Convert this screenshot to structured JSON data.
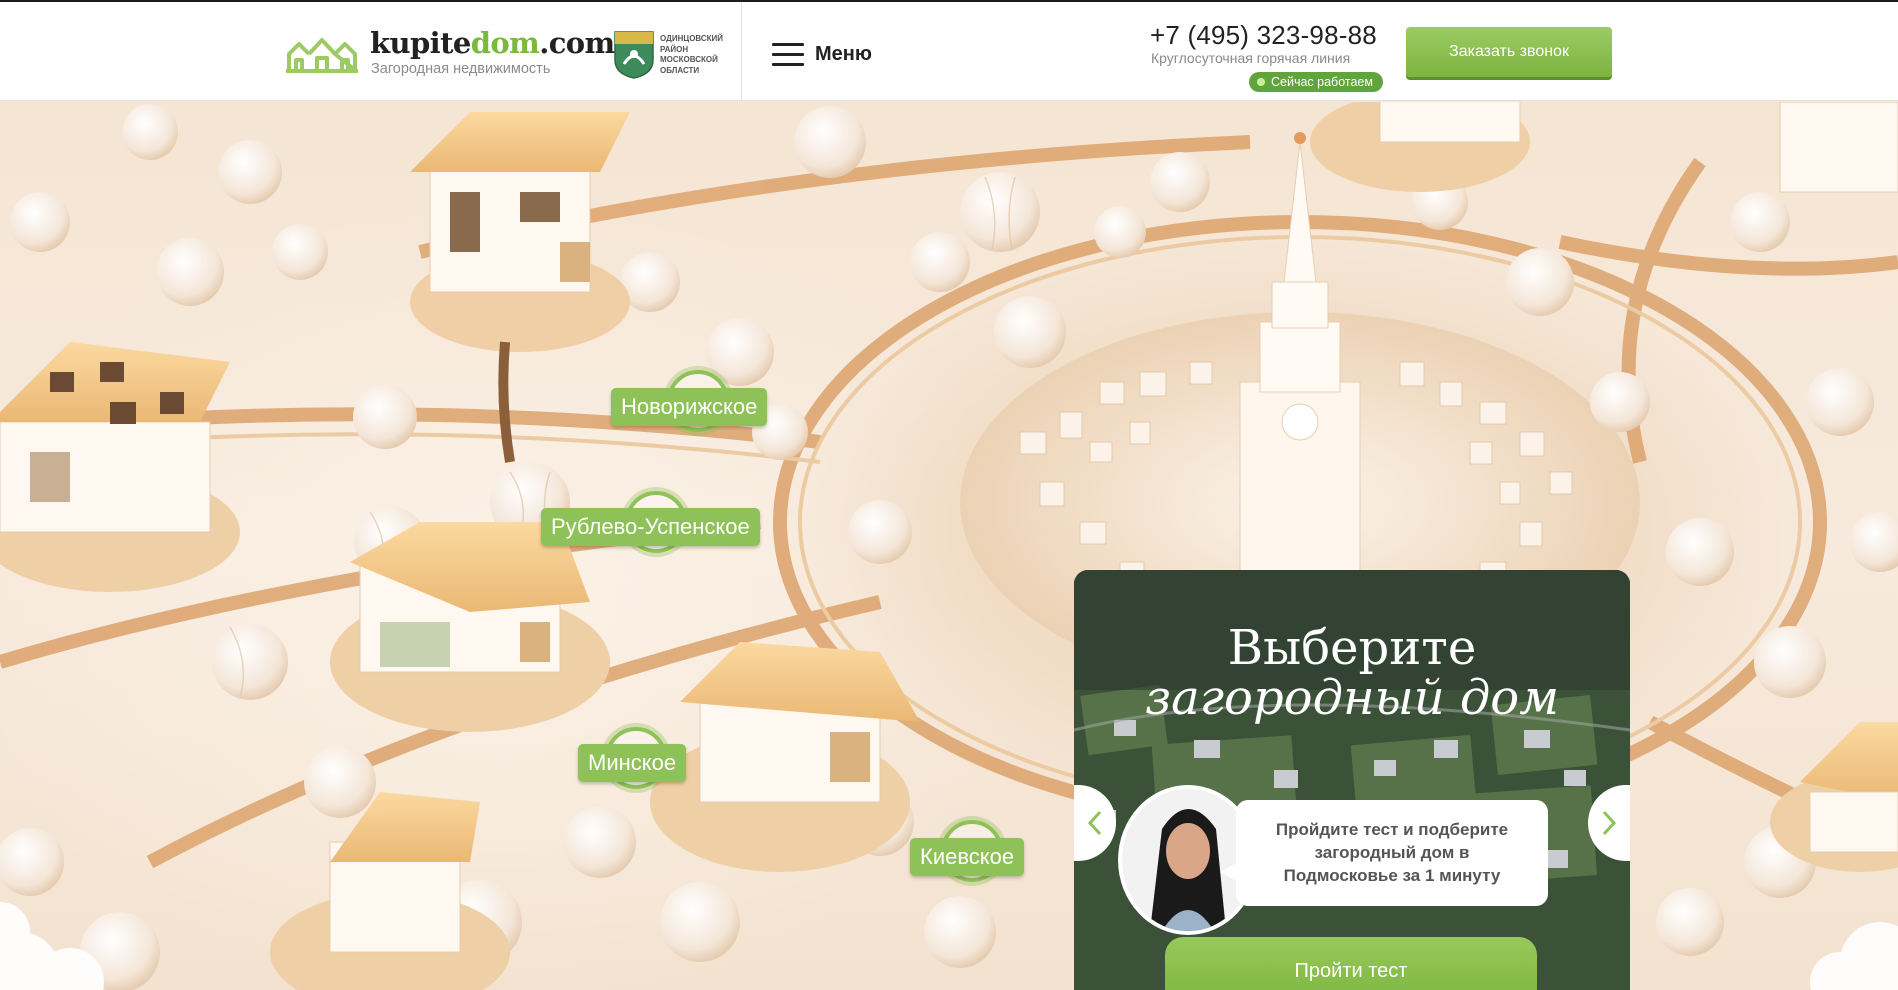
{
  "header": {
    "logo": {
      "text_main": "kupite",
      "text_mid": "dom",
      "text_end": ".com",
      "subtitle": "Загородная недвижимость"
    },
    "region": {
      "line1": "Одинцовский",
      "line2": "район",
      "line3": "московской",
      "line4": "области"
    },
    "menu_label": "Меню",
    "phone": "+7 (495) 323-98-88",
    "hotline": "Круглосуточная горячая линия",
    "status": "Сейчас работаем",
    "callback_label": "Заказать звонок"
  },
  "highways": [
    {
      "name": "Новорижское"
    },
    {
      "name": "Рублево-Успенское"
    },
    {
      "name": "Минское"
    },
    {
      "name": "Киевское"
    }
  ],
  "quiz": {
    "title_line1": "Выберите",
    "title_line2": "загородный дом",
    "bubble_text": "Пройдите тест и подберите загородный дом в Подмосковье за 1 минуту",
    "button_label": "Пройти тест"
  },
  "colors": {
    "brand_green": "#8ec157",
    "status_green": "#5fa53c",
    "gold": "#d9a066"
  },
  "icons": [
    "logo-houses-icon",
    "coat-of-arms-icon",
    "hamburger-icon",
    "chevron-left-icon",
    "chevron-right-icon"
  ]
}
